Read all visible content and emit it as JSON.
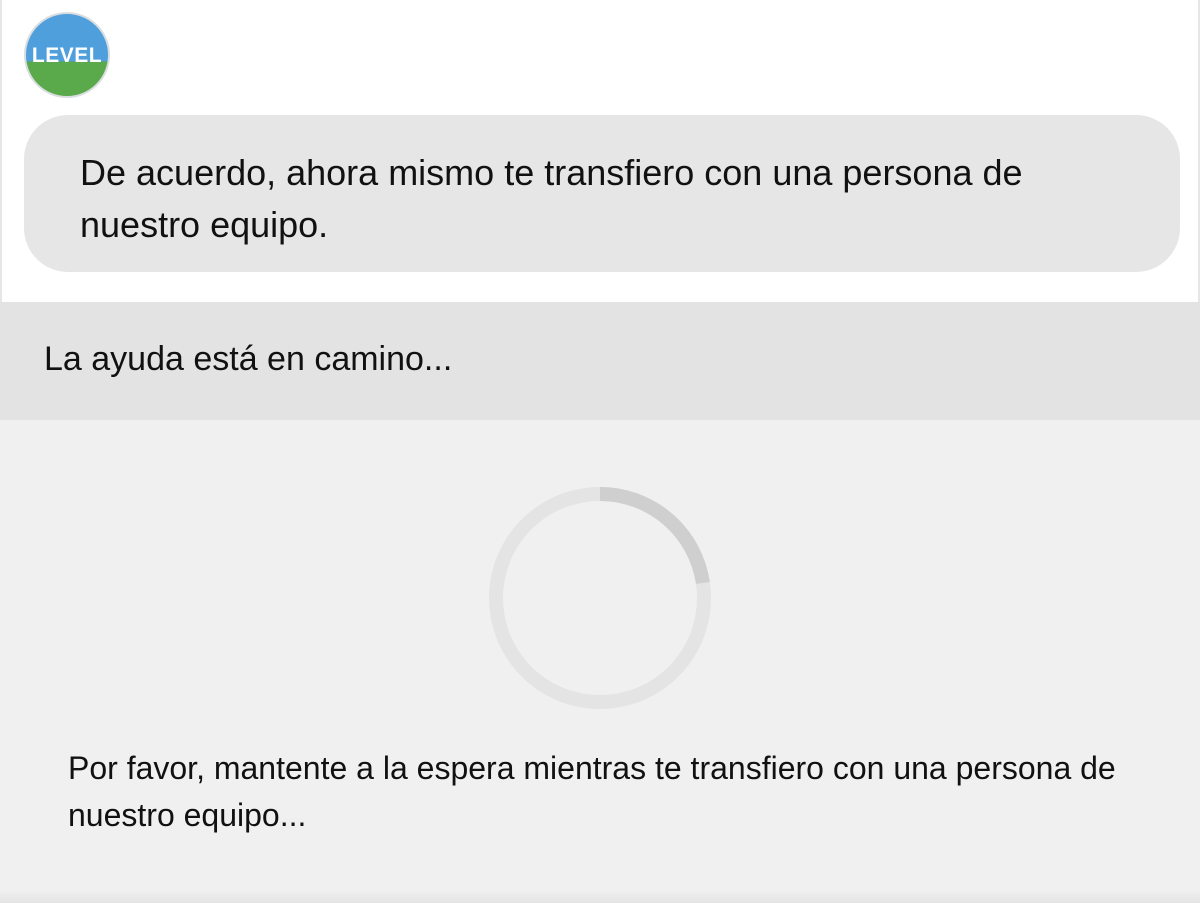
{
  "avatar": {
    "label": "LEVEL",
    "colors": {
      "top": "#4f9fdc",
      "bottom": "#5aa94a"
    }
  },
  "chat": {
    "bot_message": "De acuerdo, ahora mismo te transfiero con una persona de nuestro equipo."
  },
  "status": {
    "text": "La ayuda está en camino..."
  },
  "transfer": {
    "spinner_icon": "loading-spinner-icon",
    "wait_message": "Por favor, mantente a la espera mientras te transfiero con una persona de nuestro equipo..."
  },
  "colors": {
    "bubble_bg": "#e6e6e6",
    "status_bg": "#e3e3e3",
    "panel_bg": "#f0f0f0"
  }
}
